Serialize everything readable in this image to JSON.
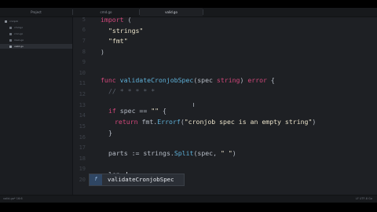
{
  "tabs": [
    {
      "label": "Project"
    },
    {
      "label": "cmd.go"
    },
    {
      "label": "valid.go"
    },
    {
      "label": ""
    }
  ],
  "sidebar": {
    "items": [
      {
        "label": "cronjob",
        "level": 0
      },
      {
        "label": "cmd.go",
        "level": 1
      },
      {
        "label": "cron.go",
        "level": 1
      },
      {
        "label": "main.go",
        "level": 1
      },
      {
        "label": "valid.go",
        "level": 1
      }
    ]
  },
  "gutter": {
    "numbers": [
      "5",
      "6",
      "7",
      "8",
      "9",
      "10",
      "11",
      "12",
      "13",
      "14",
      "15",
      "16",
      "17",
      "18",
      "19",
      "20"
    ]
  },
  "code": {
    "l1": {
      "kw": "import",
      "rest": " ("
    },
    "l2": {
      "str": "\"strings\""
    },
    "l3": {
      "str": "\"fmt\""
    },
    "l4": {
      "pl": ")"
    },
    "l7": {
      "kw": "func",
      "fn": "validateCronjobSpec",
      "rest": "(spec ",
      "tp": "string",
      "rest2": ") ",
      "tp2": "error",
      "rest3": " {"
    },
    "l8": {
      "cm": "// * * * * *"
    },
    "l10": {
      "kw": "if",
      "rest": " spec == ",
      "str": "\"\"",
      "rest2": " {"
    },
    "l11": {
      "kw": "return",
      "rest": " fmt.",
      "fn": "Errorf",
      "rest2": "(",
      "str": "\"cronjob spec is an empty string\"",
      "rest3": ")"
    },
    "l12": {
      "pl": "}"
    },
    "l14": {
      "rest": "parts := strings.",
      "fn": "Split",
      "rest2": "(spec, ",
      "str": "\" \"",
      "rest3": ")"
    },
    "l16": {
      "pl": "len"
    }
  },
  "autocomplete": {
    "kind": "f",
    "suggestion": "validateCronjobSpec"
  },
  "status": {
    "left": "valid.go*  16:6",
    "right": "LF  UTF-8  Go"
  }
}
